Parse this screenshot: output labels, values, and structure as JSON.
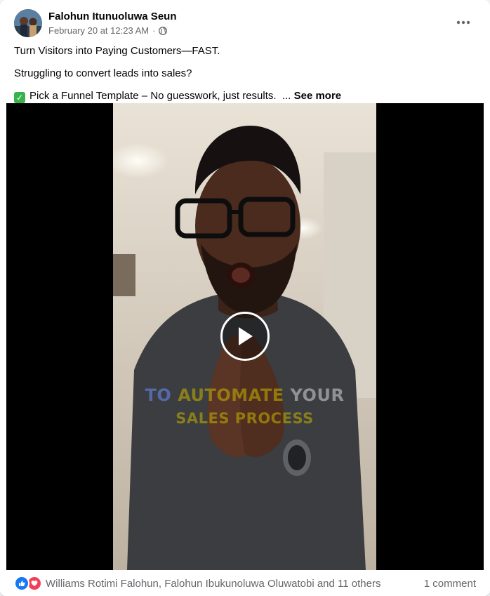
{
  "post": {
    "author": "Falohun Itunuoluwa Seun",
    "timestamp": "February 20 at 12:23 AM",
    "separator": "·",
    "privacy_icon": "globe-icon",
    "more_icon": "more-options-icon",
    "lines": [
      "Turn Visitors into Paying Customers—FAST.",
      "Struggling to convert leads into sales?",
      "Pick a Funnel Template – No guesswork, just results."
    ],
    "line3_prefix_icon": "check-mark-emoji",
    "ellipsis": "...",
    "see_more": "See more"
  },
  "video": {
    "play_icon": "play-icon",
    "caption_line1": [
      "TO",
      "AUTOMATE",
      "YOUR"
    ],
    "caption_line2": "SALES PROCESS"
  },
  "footer": {
    "reaction_icons": [
      "like-icon",
      "love-icon"
    ],
    "reactions_text": "Williams Rotimi Falohun, Falohun Ibukunoluwa Oluwatobi and 11 others",
    "comments_text": "1 comment"
  },
  "colors": {
    "like": "#1877f2",
    "love": "#f33e58",
    "check": "#38b24a",
    "secondary_text": "#65676b"
  }
}
